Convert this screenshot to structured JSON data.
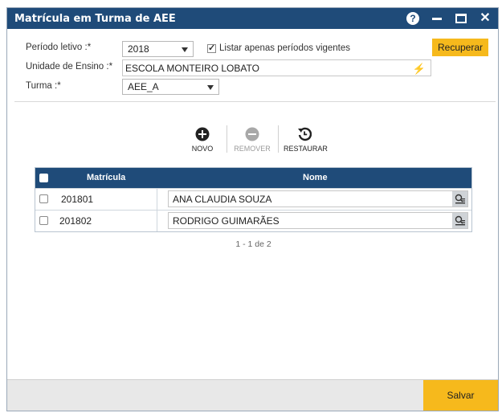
{
  "window": {
    "title": "Matrícula em Turma de AEE",
    "help_label": "?"
  },
  "form": {
    "periodo_label": "Período letivo :*",
    "periodo_value": "2018",
    "listar_label": "Listar apenas períodos vigentes",
    "listar_checked": true,
    "unidade_label": "Unidade de Ensino :*",
    "unidade_value": "ESCOLA MONTEIRO LOBATO",
    "turma_label": "Turma :*",
    "turma_value": "AEE_A",
    "recuperar_label": "Recuperar"
  },
  "toolbar": {
    "novo_label": "NOVO",
    "remover_label": "REMOVER",
    "restaurar_label": "RESTAURAR"
  },
  "grid": {
    "headers": {
      "matricula": "Matrícula",
      "nome": "Nome"
    },
    "rows": [
      {
        "matricula": "201801",
        "nome": "ANA CLAUDIA SOUZA"
      },
      {
        "matricula": "201802",
        "nome": "RODRIGO GUIMARÃES"
      }
    ],
    "pager": "1 - 1 de 2"
  },
  "footer": {
    "salvar_label": "Salvar"
  },
  "colors": {
    "titlebar": "#1f4b79",
    "accent": "#f6b91c"
  }
}
